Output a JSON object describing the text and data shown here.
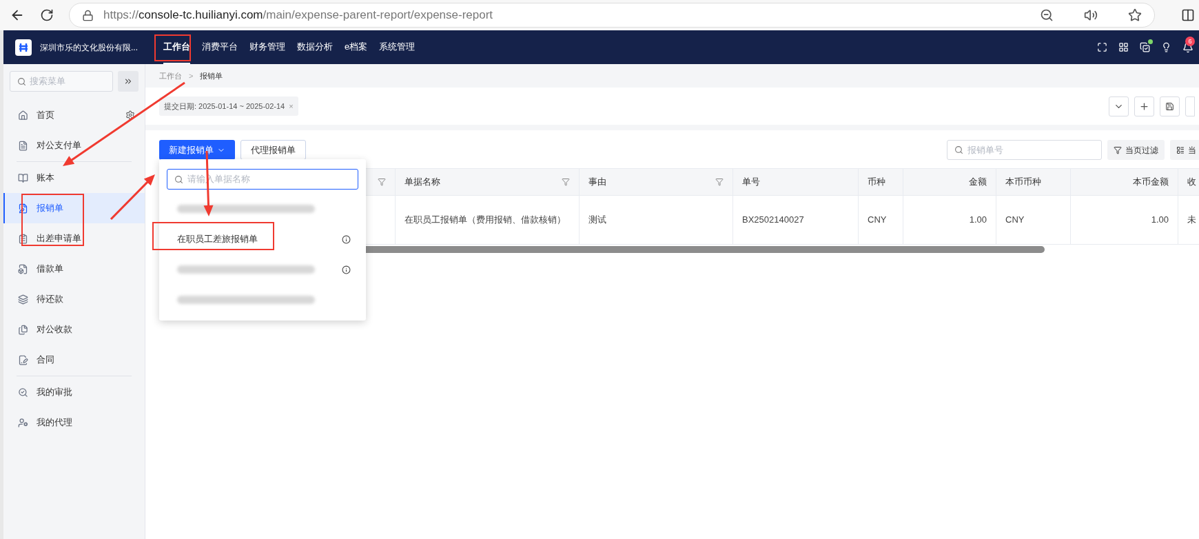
{
  "browser": {
    "url_scheme": "https://",
    "url_host": "console-tc.huilianyi.com",
    "url_path": "/main/expense-parent-report/expense-report"
  },
  "topbar": {
    "company": "深圳市乐的文化股份有限...",
    "nav": [
      {
        "label": "工作台",
        "selected": true
      },
      {
        "label": "消费平台",
        "selected": false
      },
      {
        "label": "财务管理",
        "selected": false
      },
      {
        "label": "数据分析",
        "selected": false
      },
      {
        "label": "e档案",
        "selected": false
      },
      {
        "label": "系统管理",
        "selected": false
      }
    ],
    "notification_count": "6"
  },
  "sidebar": {
    "search_placeholder": "搜索菜单",
    "items": [
      {
        "label": "首页",
        "selected": false
      },
      {
        "label": "对公支付单",
        "selected": false
      },
      {
        "label": "账本",
        "selected": false
      },
      {
        "label": "报销单",
        "selected": true
      },
      {
        "label": "出差申请单",
        "selected": false
      },
      {
        "label": "借款单",
        "selected": false
      },
      {
        "label": "待还款",
        "selected": false
      },
      {
        "label": "对公收款",
        "selected": false
      },
      {
        "label": "合同",
        "selected": false
      },
      {
        "label": "我的审批",
        "selected": false
      },
      {
        "label": "我的代理",
        "selected": false
      }
    ]
  },
  "breadcrumb": [
    "工作台",
    "报销单"
  ],
  "breadcrumb_separator": ">",
  "filter_tag": "提交日期: 2025-01-14 ~ 2025-02-14",
  "filter_tag_close": "×",
  "toolbar": {
    "new_button": "新建报销单",
    "proxy_button": "代理报销单",
    "search_placeholder": "报销单号",
    "page_filter": "当页过滤",
    "columns_button": "当"
  },
  "dropdown": {
    "search_placeholder": "请输入单据名称",
    "items": [
      {
        "kind": "blurred",
        "info": false
      },
      {
        "kind": "text",
        "label": "在职员工差旅报销单",
        "info": true
      },
      {
        "kind": "blurred",
        "info": true
      },
      {
        "kind": "blurred",
        "info": false
      }
    ]
  },
  "table": {
    "columns": [
      {
        "filter": true
      },
      {
        "label": "单据名称",
        "filter": true
      },
      {
        "label": "事由",
        "filter": true
      },
      {
        "label": "单号",
        "filter": false
      },
      {
        "label": "币种",
        "filter": false
      },
      {
        "label": "金额",
        "filter": false
      },
      {
        "label": "本币币种",
        "filter": false
      },
      {
        "label": "本币金额",
        "filter": false
      },
      {
        "label": "收"
      }
    ],
    "rows": [
      [
        null,
        "在职员工报销单（费用报销、借款核销）",
        "测试",
        "BX2502140027",
        "CNY",
        "1.00",
        "CNY",
        "1.00",
        "未"
      ]
    ]
  }
}
